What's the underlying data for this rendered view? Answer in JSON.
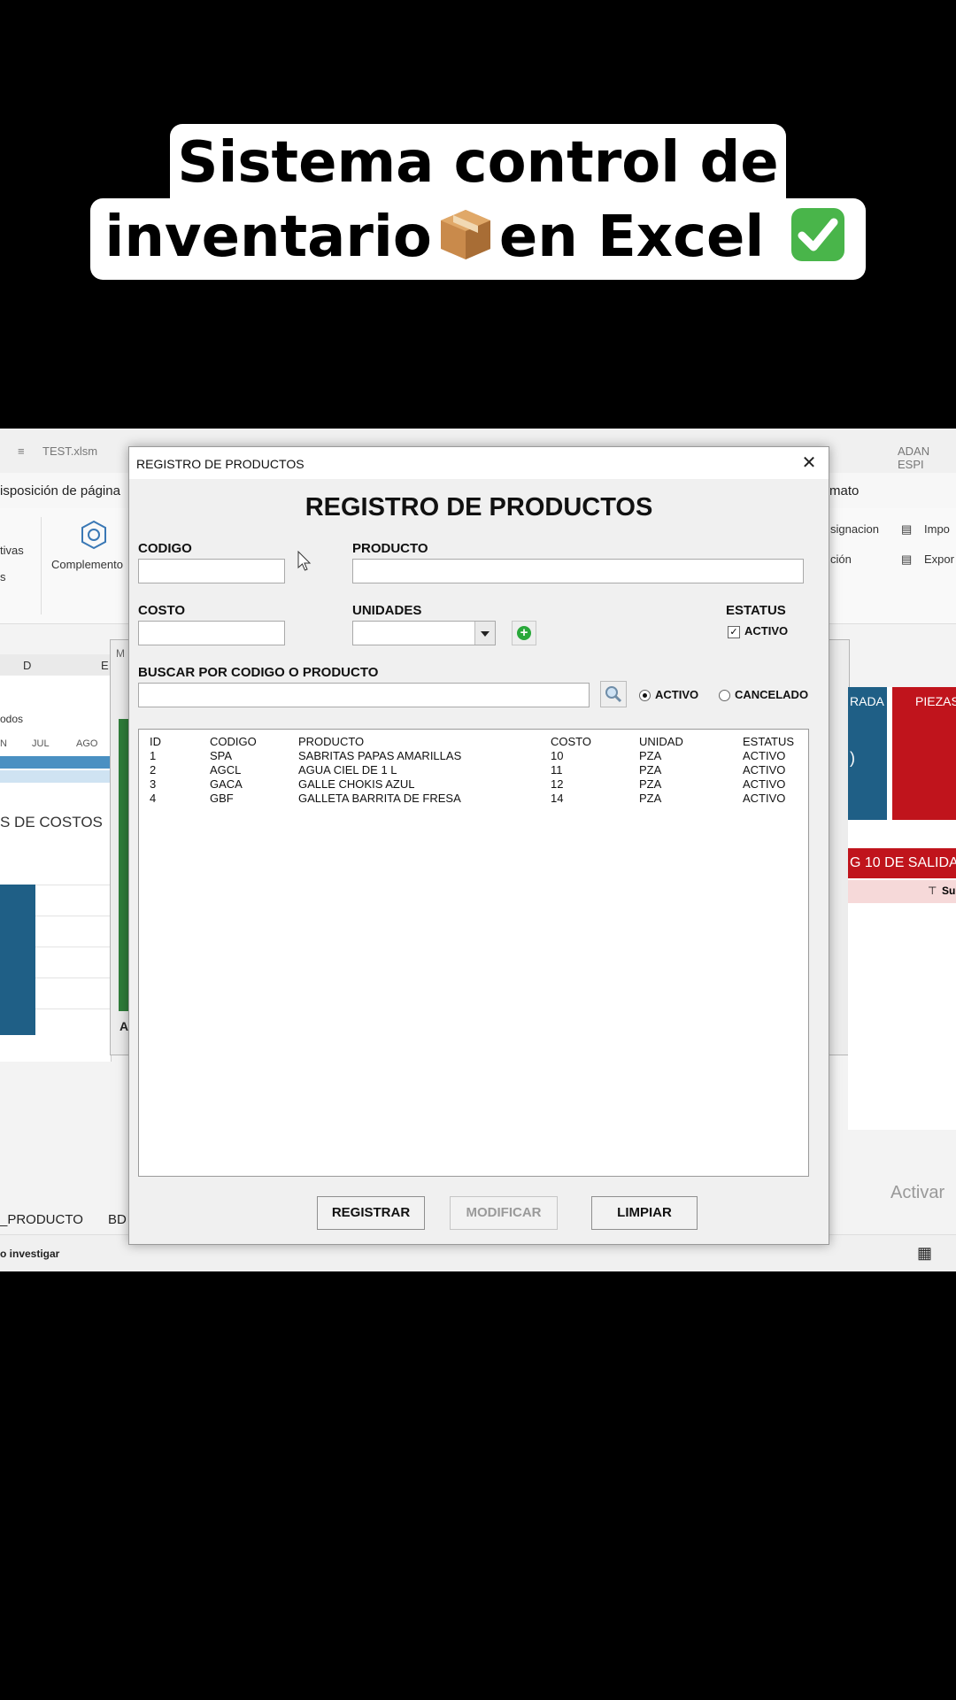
{
  "caption": {
    "line1": "Sistema control de",
    "line2_part1": "inventario",
    "line2_part2": "en Excel",
    "icons": [
      "package-emoji",
      "check-mark-emoji"
    ]
  },
  "excel": {
    "file_name": "TEST.xlsm",
    "user": "ADAN ESPI",
    "menu_left": "isposición de página",
    "menu_right": "rmato",
    "ribbon": {
      "item1": "tivas",
      "item2": "s",
      "complementos": "Complemento",
      "asignacion": "signacion",
      "opcion": "ción",
      "importar": "Impo",
      "exportar": "Expor"
    },
    "column_d": "D",
    "column_e": "E",
    "periodos": "odos",
    "months": [
      "N",
      "JUL",
      "AGO"
    ],
    "costos_label": "S DE COSTOS",
    "tile_left": "RADA",
    "tile_left_value": ")",
    "tile_right": "PIEZAS",
    "red_banner": "G 10 DE SALIDA",
    "pink_label": "Su",
    "behind_dialog_label": "A",
    "behind_dialog_title": "M",
    "sheet_tab1": "_PRODUCTO",
    "sheet_tab2": "BD",
    "status_text": "o investigar",
    "activar": "Activar",
    "colors": {
      "teal": "#1f5f86",
      "red": "#c0141c",
      "green": "#2f7d3a"
    }
  },
  "dialog": {
    "window_title": "REGISTRO DE PRODUCTOS",
    "heading": "REGISTRO DE PRODUCTOS",
    "labels": {
      "codigo": "CODIGO",
      "producto": "PRODUCTO",
      "costo": "COSTO",
      "unidades": "UNIDADES",
      "estatus": "ESTATUS",
      "buscar": "BUSCAR POR CODIGO O PRODUCTO"
    },
    "fields": {
      "codigo": "",
      "producto": "",
      "costo": "",
      "unidades": "",
      "buscar": ""
    },
    "estatus_checkbox": {
      "label": "ACTIVO",
      "checked": true
    },
    "filter": {
      "activo_label": "ACTIVO",
      "cancelado_label": "CANCELADO",
      "selected": "ACTIVO"
    },
    "table": {
      "headers": [
        "ID",
        "CODIGO",
        "PRODUCTO",
        "COSTO",
        "UNIDAD",
        "ESTATUS"
      ],
      "rows": [
        [
          "1",
          "SPA",
          "SABRITAS PAPAS AMARILLAS",
          "10",
          "PZA",
          "ACTIVO"
        ],
        [
          "2",
          "AGCL",
          "AGUA CIEL DE 1 L",
          "11",
          "PZA",
          "ACTIVO"
        ],
        [
          "3",
          "GACA",
          "GALLE CHOKIS AZUL",
          "12",
          "PZA",
          "ACTIVO"
        ],
        [
          "4",
          "GBF",
          "GALLETA BARRITA DE FRESA",
          "14",
          "PZA",
          "ACTIVO"
        ]
      ]
    },
    "buttons": {
      "registrar": "REGISTRAR",
      "modificar": "MODIFICAR",
      "limpiar": "LIMPIAR"
    },
    "close_glyph": "✕",
    "check_glyph": "✓",
    "plus_glyph": "+"
  }
}
